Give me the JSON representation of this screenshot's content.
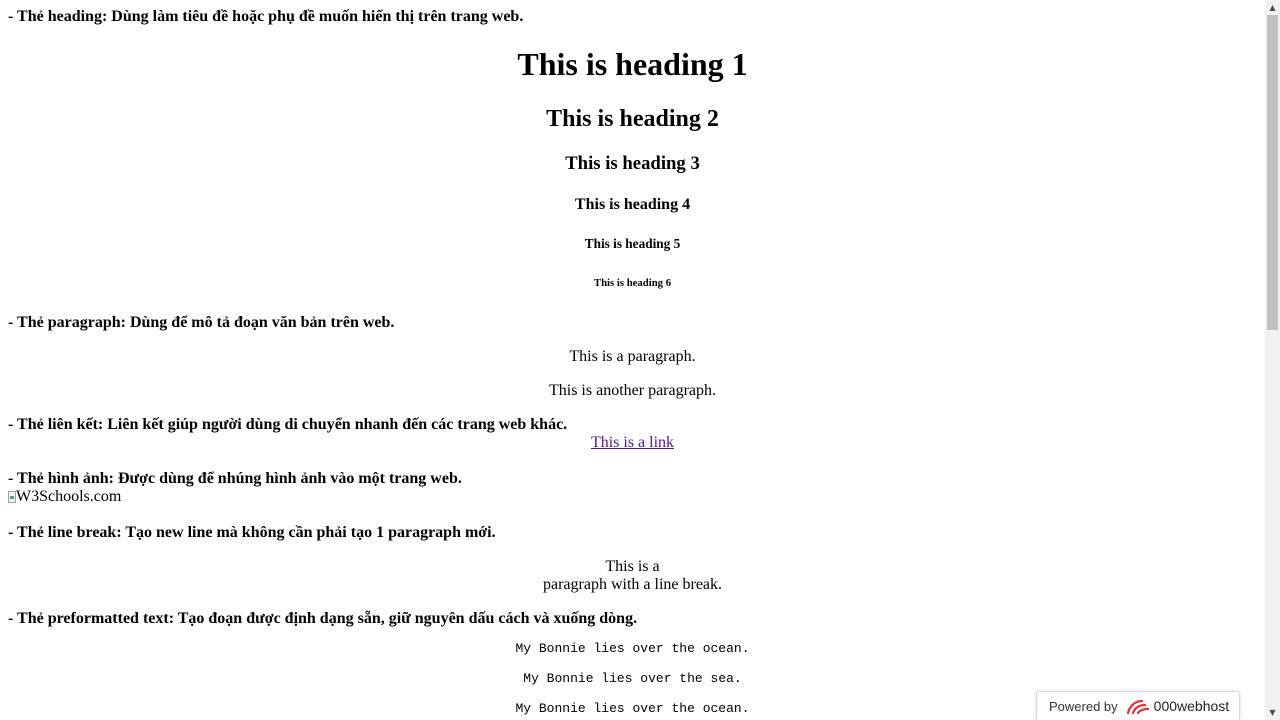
{
  "sections": {
    "heading": "- Thẻ heading: Dùng làm tiêu đề hoặc phụ đề muốn hiển thị trên trang web.",
    "paragraph": "- Thẻ paragraph: Dùng để mô tả đoạn văn bản trên web.",
    "link": "- Thẻ liên kết: Liên kết giúp người dùng di chuyển nhanh đến các trang web khác.",
    "image": "- Thẻ hình ảnh: Được dùng để nhúng hình ảnh vào một trang web.",
    "line_break": "- Thẻ line break: Tạo new line mà không cần phải tạo 1 paragraph mới.",
    "preformatted": "- Thẻ preformatted text: Tạo đoạn được định dạng sẵn, giữ nguyên dấu cách và xuống dòng."
  },
  "headings": {
    "h1": "This is heading 1",
    "h2": "This is heading 2",
    "h3": "This is heading 3",
    "h4": "This is heading 4",
    "h5": "This is heading 5",
    "h6": "This is heading 6"
  },
  "paragraphs": {
    "p1": "This is a paragraph.",
    "p2": "This is another paragraph."
  },
  "link": {
    "text": "This is a link"
  },
  "image": {
    "alt": "W3Schools.com"
  },
  "line_break": {
    "line1": "This is a",
    "line2": "paragraph with a line break."
  },
  "pre": {
    "line1": "My Bonnie lies over the ocean.",
    "line2": "My Bonnie lies over the sea.",
    "line3": "My Bonnie lies over the ocean."
  },
  "badge": {
    "prefix": "Powered by",
    "brand": "000webhost"
  },
  "colors": {
    "link": "#551a8b",
    "badge_logo": "#e8303a"
  }
}
